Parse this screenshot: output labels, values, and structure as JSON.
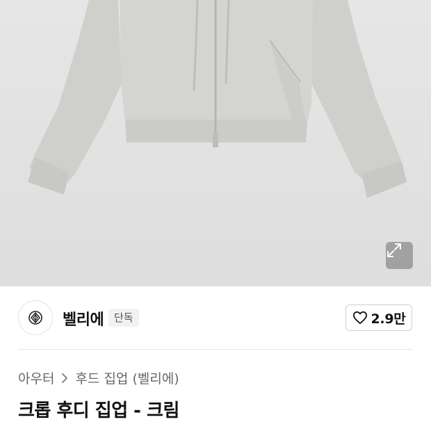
{
  "hero": {
    "image_alt": "크롭 후디 집업 - 크림",
    "background_color": "#e3e3e3",
    "expand_icon": "expand-arrows-icon"
  },
  "brand": {
    "name": "벨리에",
    "badge": "단독",
    "logo_icon": "brand-logo-icon"
  },
  "like": {
    "icon": "heart-outline-icon",
    "count": "2.9만"
  },
  "breadcrumb": {
    "items": [
      "아우터",
      "후드 집업 (벨리에)"
    ],
    "separator_icon": "chevron-right-icon"
  },
  "product": {
    "title": "크롭 후디 집업 - 크림"
  }
}
